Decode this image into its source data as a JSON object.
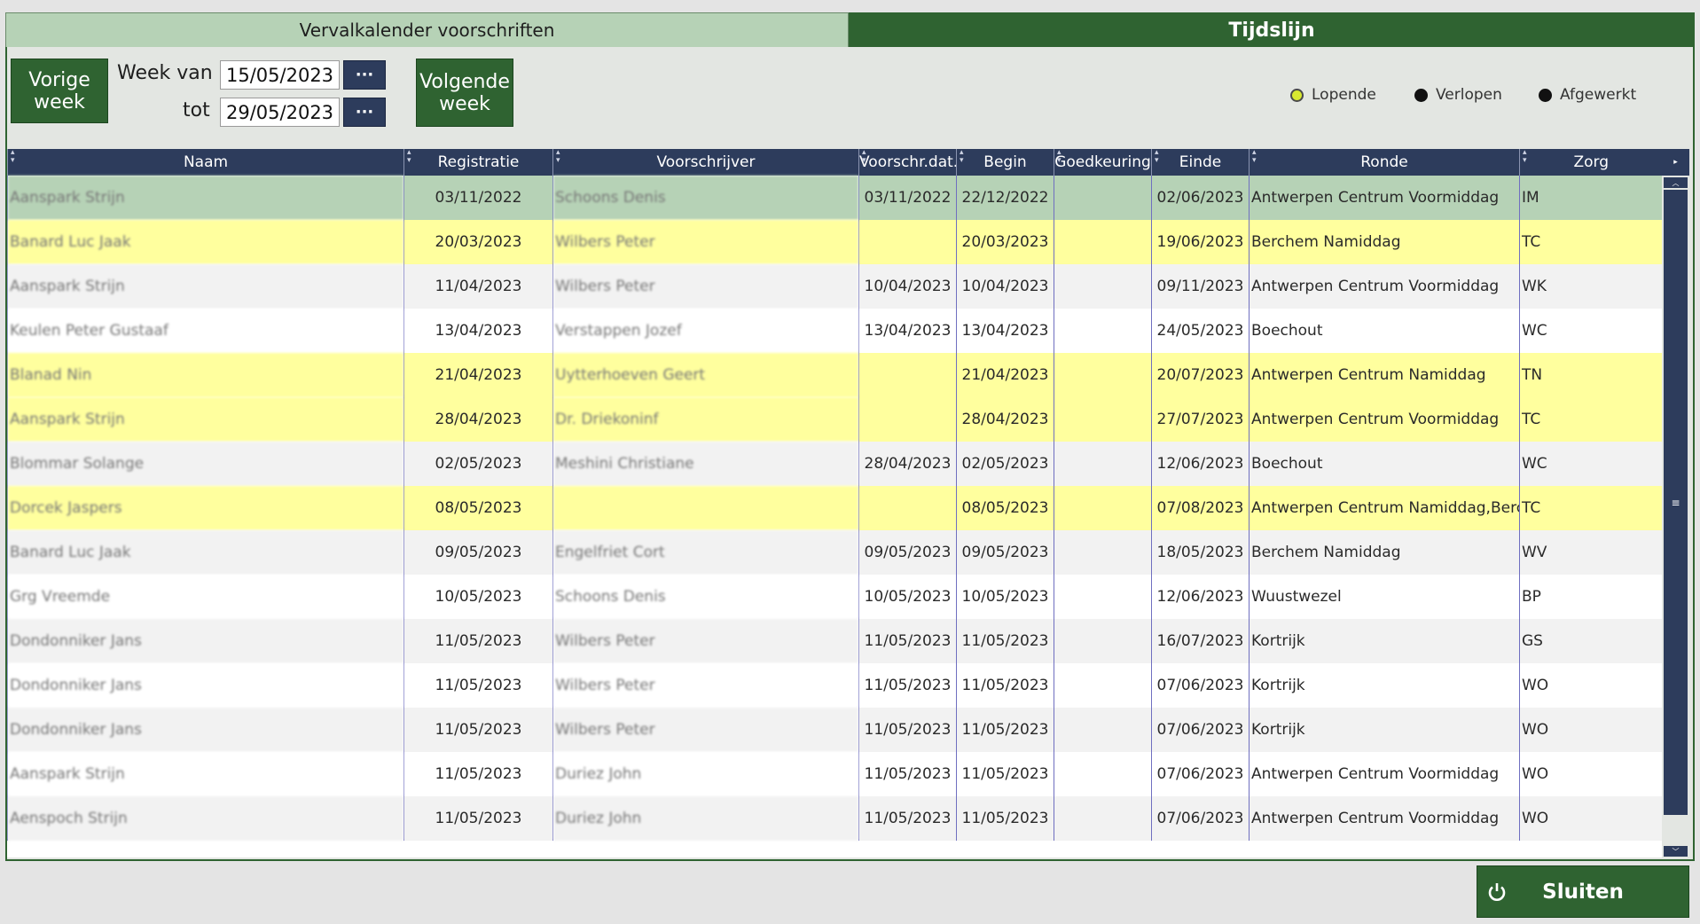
{
  "tabs": [
    {
      "label": "Vervalkalender voorschriften",
      "active": false
    },
    {
      "label": "Tijdslijn",
      "active": true
    }
  ],
  "toolbar": {
    "prev_week": "Vorige week",
    "next_week": "Volgende week",
    "week_van_label": "Week van",
    "tot_label": "tot",
    "date_from": "15/05/2023",
    "date_to": "29/05/2023",
    "dots": "···"
  },
  "legend": [
    {
      "label": "Lopende",
      "color": "#d8e830"
    },
    {
      "label": "Verlopen",
      "color": "#111111"
    },
    {
      "label": "Afgewerkt",
      "color": "#111111"
    }
  ],
  "table": {
    "columns": [
      "Naam",
      "Registratie",
      "Voorschrijver",
      "Voorschr.dat.",
      "Begin",
      "Goedkeuring",
      "Einde",
      "Ronde",
      "Zorg"
    ],
    "rows": [
      {
        "style": "sel",
        "naam": "Aanspark Strijn",
        "registratie": "03/11/2022",
        "voorschrijver": "Schoons Denis",
        "voorschr_dat": "03/11/2022",
        "begin": "22/12/2022",
        "goedkeuring": "",
        "einde": "02/06/2023",
        "ronde": "Antwerpen Centrum Voormiddag",
        "zorg": "IM"
      },
      {
        "style": "yel",
        "naam": "Banard Luc Jaak",
        "registratie": "20/03/2023",
        "voorschrijver": "Wilbers Peter",
        "voorschr_dat": "",
        "begin": "20/03/2023",
        "goedkeuring": "",
        "einde": "19/06/2023",
        "ronde": "Berchem Namiddag",
        "zorg": "TC"
      },
      {
        "style": "alt",
        "naam": "Aanspark Strijn",
        "registratie": "11/04/2023",
        "voorschrijver": "Wilbers Peter",
        "voorschr_dat": "10/04/2023",
        "begin": "10/04/2023",
        "goedkeuring": "",
        "einde": "09/11/2023",
        "ronde": "Antwerpen Centrum Voormiddag",
        "zorg": "WK"
      },
      {
        "style": "wht",
        "naam": "Keulen Peter Gustaaf",
        "registratie": "13/04/2023",
        "voorschrijver": "Verstappen Jozef",
        "voorschr_dat": "13/04/2023",
        "begin": "13/04/2023",
        "goedkeuring": "",
        "einde": "24/05/2023",
        "ronde": "Boechout",
        "zorg": "WC"
      },
      {
        "style": "yel",
        "naam": "Blanad Nin",
        "registratie": "21/04/2023",
        "voorschrijver": "Uytterhoeven Geert",
        "voorschr_dat": "",
        "begin": "21/04/2023",
        "goedkeuring": "",
        "einde": "20/07/2023",
        "ronde": "Antwerpen Centrum Namiddag",
        "zorg": "TN"
      },
      {
        "style": "yel",
        "naam": "Aanspark Strijn",
        "registratie": "28/04/2023",
        "voorschrijver": "Dr. Driekoninf",
        "voorschr_dat": "",
        "begin": "28/04/2023",
        "goedkeuring": "",
        "einde": "27/07/2023",
        "ronde": "Antwerpen Centrum Voormiddag",
        "zorg": "TC"
      },
      {
        "style": "alt",
        "naam": "Blommar Solange",
        "registratie": "02/05/2023",
        "voorschrijver": "Meshini Christiane",
        "voorschr_dat": "28/04/2023",
        "begin": "02/05/2023",
        "goedkeuring": "",
        "einde": "12/06/2023",
        "ronde": "Boechout",
        "zorg": "WC"
      },
      {
        "style": "yel",
        "naam": "Dorcek Jaspers",
        "registratie": "08/05/2023",
        "voorschrijver": "",
        "voorschr_dat": "",
        "begin": "08/05/2023",
        "goedkeuring": "",
        "einde": "07/08/2023",
        "ronde": "Antwerpen Centrum Namiddag,Berch",
        "zorg": "TC"
      },
      {
        "style": "alt",
        "naam": "Banard Luc Jaak",
        "registratie": "09/05/2023",
        "voorschrijver": "Engelfriet Cort",
        "voorschr_dat": "09/05/2023",
        "begin": "09/05/2023",
        "goedkeuring": "",
        "einde": "18/05/2023",
        "ronde": "Berchem Namiddag",
        "zorg": "WV"
      },
      {
        "style": "wht",
        "naam": "Grg Vreemde",
        "registratie": "10/05/2023",
        "voorschrijver": "Schoons Denis",
        "voorschr_dat": "10/05/2023",
        "begin": "10/05/2023",
        "goedkeuring": "",
        "einde": "12/06/2023",
        "ronde": "Wuustwezel",
        "zorg": "BP"
      },
      {
        "style": "alt",
        "naam": "Dondonniker Jans",
        "registratie": "11/05/2023",
        "voorschrijver": "Wilbers Peter",
        "voorschr_dat": "11/05/2023",
        "begin": "11/05/2023",
        "goedkeuring": "",
        "einde": "16/07/2023",
        "ronde": "Kortrijk",
        "zorg": "GS"
      },
      {
        "style": "wht",
        "naam": "Dondonniker Jans",
        "registratie": "11/05/2023",
        "voorschrijver": "Wilbers Peter",
        "voorschr_dat": "11/05/2023",
        "begin": "11/05/2023",
        "goedkeuring": "",
        "einde": "07/06/2023",
        "ronde": "Kortrijk",
        "zorg": "WO"
      },
      {
        "style": "alt",
        "naam": "Dondonniker Jans",
        "registratie": "11/05/2023",
        "voorschrijver": "Wilbers Peter",
        "voorschr_dat": "11/05/2023",
        "begin": "11/05/2023",
        "goedkeuring": "",
        "einde": "07/06/2023",
        "ronde": "Kortrijk",
        "zorg": "WO"
      },
      {
        "style": "wht",
        "naam": "Aanspark Strijn",
        "registratie": "11/05/2023",
        "voorschrijver": "Duriez John",
        "voorschr_dat": "11/05/2023",
        "begin": "11/05/2023",
        "goedkeuring": "",
        "einde": "07/06/2023",
        "ronde": "Antwerpen Centrum Voormiddag",
        "zorg": "WO"
      },
      {
        "style": "alt",
        "naam": "Aenspoch Strijn",
        "registratie": "11/05/2023",
        "voorschrijver": "Duriez John",
        "voorschr_dat": "11/05/2023",
        "begin": "11/05/2023",
        "goedkeuring": "",
        "einde": "07/06/2023",
        "ronde": "Antwerpen Centrum Voormiddag",
        "zorg": "WO"
      }
    ]
  },
  "close_button": "Sluiten"
}
